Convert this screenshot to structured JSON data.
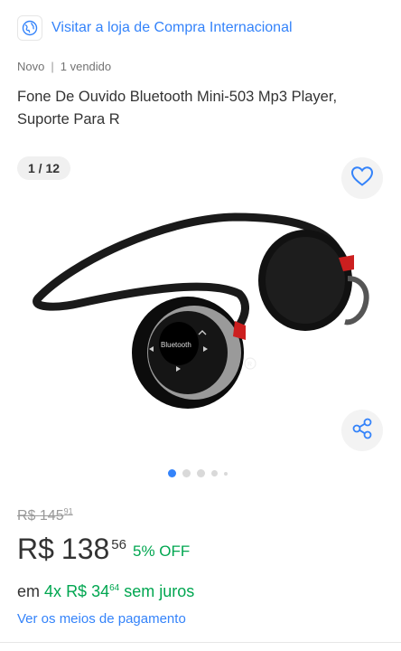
{
  "store": {
    "link_text": "Visitar a loja de Compra Internacional",
    "icon": "globe-icon"
  },
  "meta": {
    "condition": "Novo",
    "separator": "|",
    "sold": "1 vendido"
  },
  "product": {
    "title": "Fone De Ouvido Bluetooth Mini-503 Mp3 Player, Suporte Para R",
    "image_label": "Bluetooth"
  },
  "gallery": {
    "counter": "1 / 12",
    "current_image": 1,
    "total_images": 12,
    "favorite_icon": "heart-icon",
    "share_icon": "share-icon"
  },
  "pricing": {
    "old_price_currency": "R$",
    "old_price_int": "145",
    "old_price_cents": "91",
    "currency": "R$",
    "price_int": "138",
    "price_cents": "56",
    "discount": "5% OFF",
    "installments_prefix": "em",
    "installments_count": "4x",
    "installments_currency": "R$",
    "installments_int": "34",
    "installments_cents": "64",
    "installments_suffix": "sem juros",
    "payment_link": "Ver os meios de pagamento"
  },
  "colors": {
    "accent_blue": "#3483fa",
    "green": "#00a650"
  }
}
